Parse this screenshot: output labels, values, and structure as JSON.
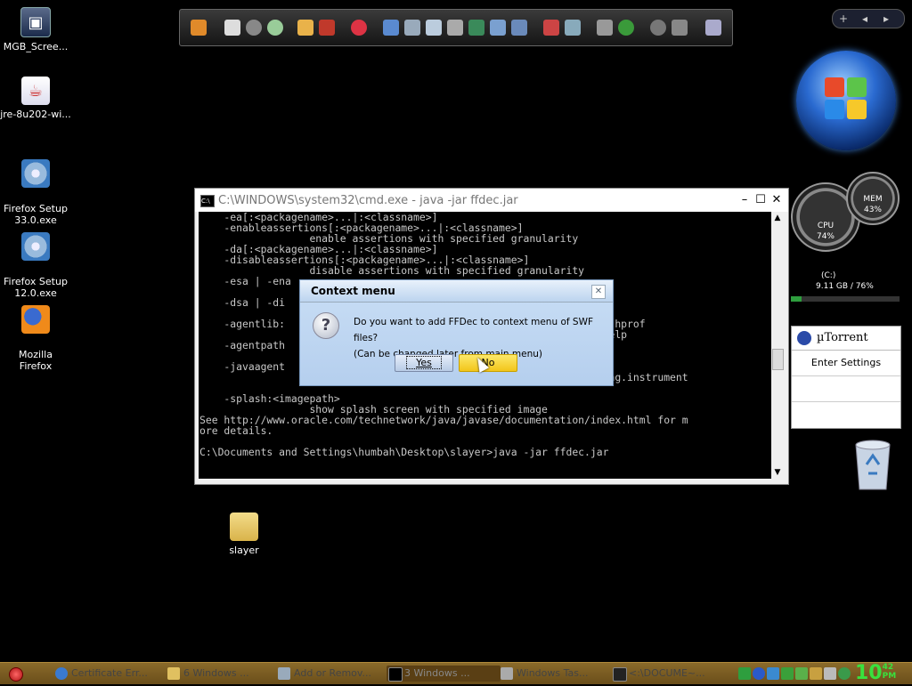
{
  "desktop_icons": [
    {
      "label": "MGB_Scree...",
      "icon": "screen-capture-icon"
    },
    {
      "label": "jre-8u202-wi...",
      "icon": "java-installer-icon"
    },
    {
      "label": "Firefox Setup\n33.0.exe",
      "icon": "setup-cd-icon"
    },
    {
      "label": "Firefox Setup\n12.0.exe",
      "icon": "setup-cd-icon"
    },
    {
      "label": "Mozilla\nFirefox",
      "icon": "firefox-icon"
    },
    {
      "label": "slayer",
      "icon": "folder-icon"
    }
  ],
  "cmd_window": {
    "title": "C:\\WINDOWS\\system32\\cmd.exe - java -jar ffdec.jar",
    "console_text": "    -ea[:<packagename>...|:<classname>]\n    -enableassertions[:<packagename>...|:<classname>]\n                  enable assertions with specified granularity\n    -da[:<packagename>...|:<classname>]\n    -disableassertions[:<packagename>...|:<classname>]\n                  disable assertions with specified granularity\n    -esa | -ena\n\n    -dsa | -di\n\n    -agentlib:                                          . -agentlib:hprof\n                                                        lib:hprof=help\n    -agentpath                                            me\n\n    -javaagent\n                  load Java programming language agent, see java.lang.instrument\n\n    -splash:<imagepath>\n                  show splash screen with specified image\nSee http://www.oracle.com/technetwork/java/javase/documentation/index.html for m\nore details.\n\nC:\\Documents and Settings\\humbah\\Desktop\\slayer>java -jar ffdec.jar"
  },
  "dialog": {
    "title": "Context menu",
    "message_line1": "Do you want to add FFDec to context menu of SWF files?",
    "message_line2": "(Can be changed later from main menu)",
    "yes_label": "Yes",
    "no_label": "No"
  },
  "gadgets": {
    "meter_left_value": "74%",
    "meter_left_label": "CPU",
    "meter_right_value": "43%",
    "meter_right_label": "MEM",
    "drive_label": "(C:)",
    "drive_info": "9.11 GB / 76%",
    "drive_used_fraction": 0.1,
    "utorrent_title": "µTorrent",
    "utorrent_item": "Enter Settings"
  },
  "virtual_desktop_buttons": [
    "+",
    "◂",
    "▸"
  ],
  "taskbar": {
    "tasks": [
      {
        "label": "Certificate Err...",
        "active": false
      },
      {
        "label": "6 Windows ...",
        "active": false
      },
      {
        "label": "Add or Remov...",
        "active": false
      },
      {
        "label": "3 Windows ...",
        "active": true
      },
      {
        "label": "Windows Tas...",
        "active": false
      },
      {
        "label": "<:\\DOCUME~...",
        "active": false
      }
    ],
    "clock_hour": "10",
    "clock_minute": "42",
    "clock_ampm": "PM"
  },
  "colors": {
    "desktop_bg": "#000000",
    "dialog_no_button": "#f2c51a",
    "clock": "#39e13e"
  }
}
